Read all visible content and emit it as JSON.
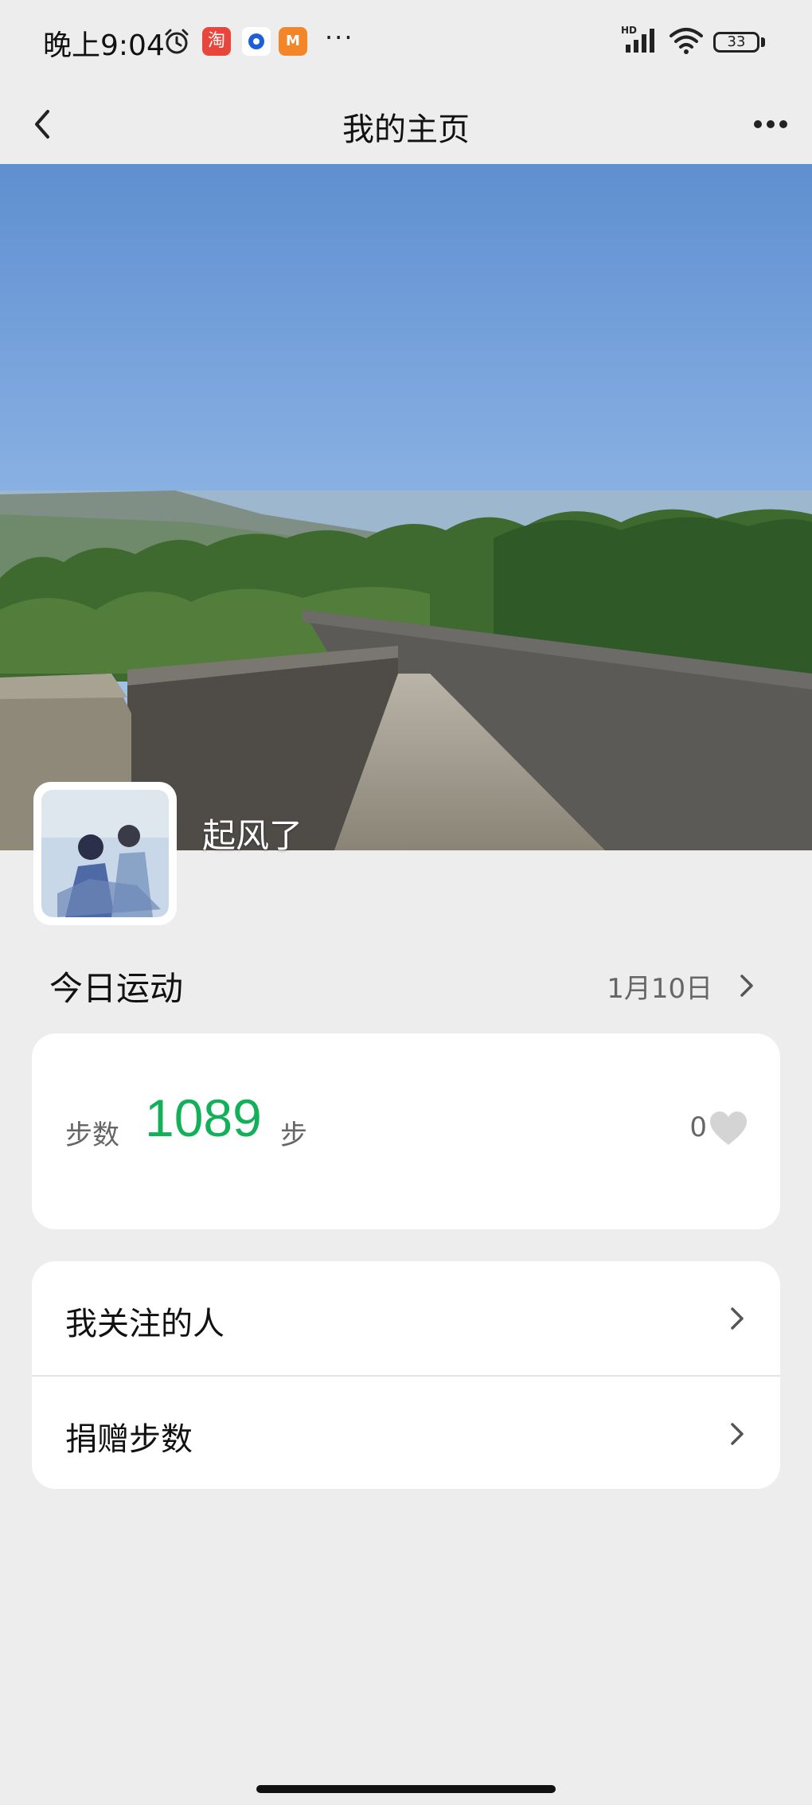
{
  "status_bar": {
    "time": "晚上9:04",
    "taobao_glyph": "淘",
    "mgtv_glyph": "M",
    "more": "···",
    "battery": "33",
    "icons": [
      "alarm-icon",
      "taobao-app-icon",
      "blue-dot-app-icon",
      "mgtv-app-icon",
      "hd-signal-icon",
      "wifi-icon",
      "battery-icon"
    ]
  },
  "nav": {
    "title": "我的主页",
    "back_icon": "chevron-left-icon",
    "more_icon": "more-dots-icon"
  },
  "profile": {
    "nickname": "起风了"
  },
  "today": {
    "title": "今日运动",
    "date": "1月10日",
    "date_icon": "chevron-right-icon"
  },
  "steps": {
    "label": "步数",
    "count": "1089",
    "unit": "步",
    "likes": "0",
    "count_color": "#12b058",
    "like_icon": "heart-icon"
  },
  "menu": {
    "items": [
      {
        "label": "我关注的人"
      },
      {
        "label": "捐赠步数"
      }
    ]
  },
  "colors": {
    "background": "#ededed",
    "card": "#ffffff",
    "accent_green": "#12b058"
  }
}
